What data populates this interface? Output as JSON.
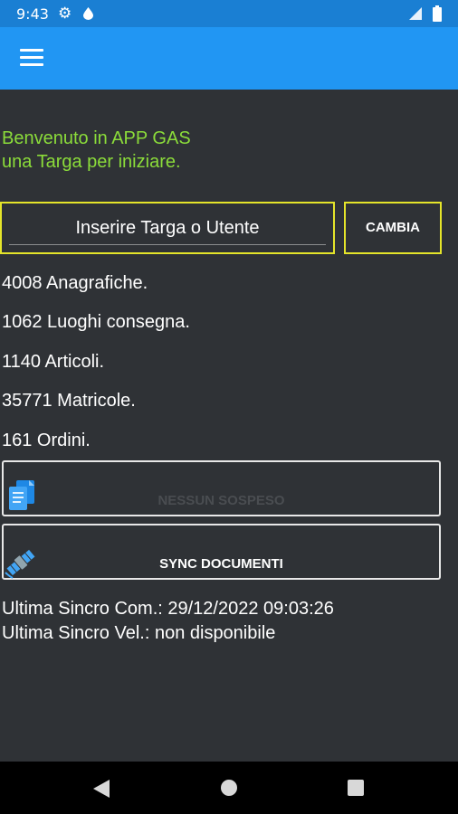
{
  "status_bar": {
    "time": "9:43",
    "icons": [
      "gear-icon",
      "drop-icon",
      "signal-icon",
      "battery-icon"
    ]
  },
  "app_bar": {
    "menu_icon": "hamburger-menu-icon",
    "color": "#2196f3"
  },
  "welcome": {
    "line1": "Benvenuto in APP GAS",
    "line2": "una Targa per iniziare.",
    "color": "#8bdc3a"
  },
  "targa": {
    "placeholder": "Inserire Targa o Utente",
    "value": "",
    "change_label": "CAMBIA",
    "border_color": "#e5e52a"
  },
  "stats": [
    "4008 Anagrafiche.",
    "1062 Luoghi consegna.",
    "1140 Articoli.",
    "35771 Matricole.",
    "161 Ordini."
  ],
  "buttons": {
    "sospeso_label": "NESSUN SOSPESO",
    "sync_label": "SYNC DOCUMENTI"
  },
  "sync_info": {
    "com": "Ultima Sincro Com.: 29/12/2022 09:03:26",
    "vel": "Ultima Sincro Vel.: non disponibile"
  },
  "colors": {
    "background": "#2f3236",
    "status_bar": "#1a7fd3",
    "nav_bar": "#000000"
  }
}
